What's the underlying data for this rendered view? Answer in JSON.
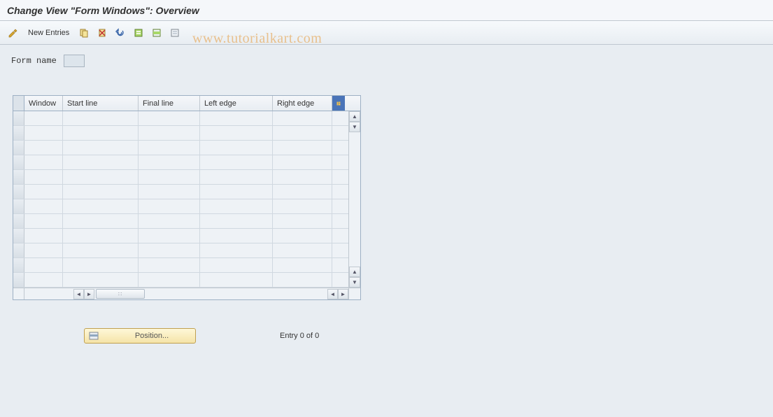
{
  "header": {
    "title": "Change View \"Form Windows\": Overview"
  },
  "toolbar": {
    "new_entries_label": "New Entries"
  },
  "watermark": "www.tutorialkart.com",
  "form": {
    "name_label": "Form name",
    "name_value": ""
  },
  "table": {
    "columns": {
      "window": "Window",
      "start_line": "Start line",
      "final_line": "Final line",
      "left_edge": "Left edge",
      "right_edge": "Right edge"
    },
    "row_count": 12
  },
  "footer": {
    "position_label": "Position...",
    "entry_text": "Entry 0 of 0"
  }
}
